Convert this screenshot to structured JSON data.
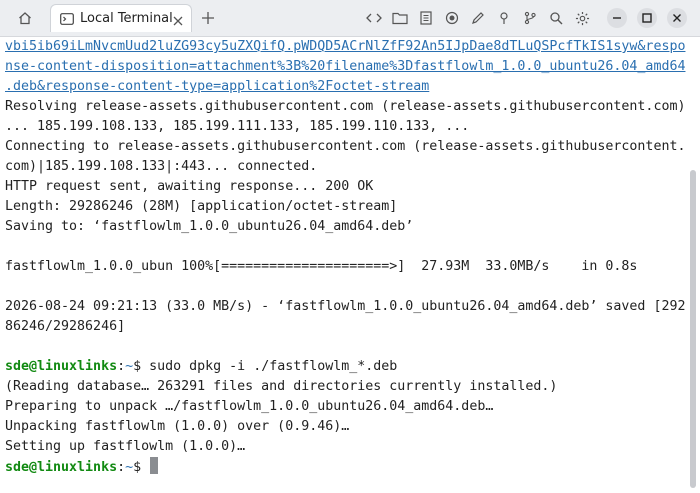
{
  "tab": {
    "title": "Local Terminal"
  },
  "terminal": {
    "url_lines": [
      "vbi5ib69iLmNvcmUud2luZG93cy5uZXQifQ.pWDQD5ACrNlZfF92An5IJpDae8dTLuQSPcfTkIS1syw&respo",
      "nse-content-disposition=attachment%3B%20filename%3Dfastflowlm_1.0.0_ubuntu26.04_amd64",
      ".deb&response-content-type=application%2Foctet-stream"
    ],
    "output_lines": [
      "Resolving release-assets.githubusercontent.com (release-assets.githubusercontent.com)",
      "... 185.199.108.133, 185.199.111.133, 185.199.110.133, ...",
      "Connecting to release-assets.githubusercontent.com (release-assets.githubusercontent.",
      "com)|185.199.108.133|:443... connected.",
      "HTTP request sent, awaiting response... 200 OK",
      "Length: 29286246 (28M) [application/octet-stream]",
      "Saving to: ‘fastflowlm_1.0.0_ubuntu26.04_amd64.deb’",
      "",
      "fastflowlm_1.0.0_ubun 100%[=====================>]  27.93M  33.0MB/s    in 0.8s",
      "",
      "2026-08-24 09:21:13 (33.0 MB/s) - ‘fastflowlm_1.0.0_ubuntu26.04_amd64.deb’ saved [292",
      "86246/29286246]",
      ""
    ],
    "prompt_user": "sde@linuxlinks",
    "prompt_sep": ":",
    "prompt_path": "~",
    "prompt_symbol": "$ ",
    "command": "sudo dpkg -i ./fastflowlm_*.deb",
    "dpkg_lines": [
      "(Reading database… 263291 files and directories currently installed.)",
      "Preparing to unpack …/fastflowlm_1.0.0_ubuntu26.04_amd64.deb…",
      "Unpacking fastflowlm (1.0.0) over (0.9.46)…",
      "Setting up fastflowlm (1.0.0)…"
    ]
  }
}
